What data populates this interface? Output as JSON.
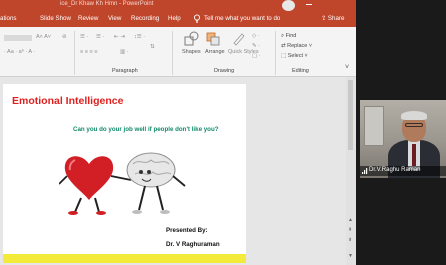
{
  "titlebar": {
    "title": "ice_Dr Khaw Kh Hmn - PowerPoint"
  },
  "tabs": [
    "ations",
    "Slide Show",
    "Review",
    "View",
    "Recording",
    "Help"
  ],
  "tell_me": "Tell me what you want to do",
  "share_label": "Share",
  "ribbon": {
    "groups": {
      "paragraph": "Paragraph",
      "drawing": "Drawing",
      "editing": "Editing"
    },
    "shapes_label": "Shapes",
    "arrange_label": "Arrange",
    "quick_styles_label": "Quick Styles",
    "find_label": "Find",
    "replace_label": "Replace",
    "select_label": "Select"
  },
  "slide": {
    "title": "Emotional Intelligence",
    "question": "Can you do your job well if people don't like you?",
    "presented_by": "Presented By:",
    "presenter": "Dr. V Raghuraman"
  },
  "video": {
    "participant_name": "Dr.V.Raghu Raman"
  },
  "colors": {
    "accent": "#c0462b",
    "title_red": "#e02020",
    "question_green": "#118a6a",
    "bar_yellow": "#f3ea3a"
  }
}
